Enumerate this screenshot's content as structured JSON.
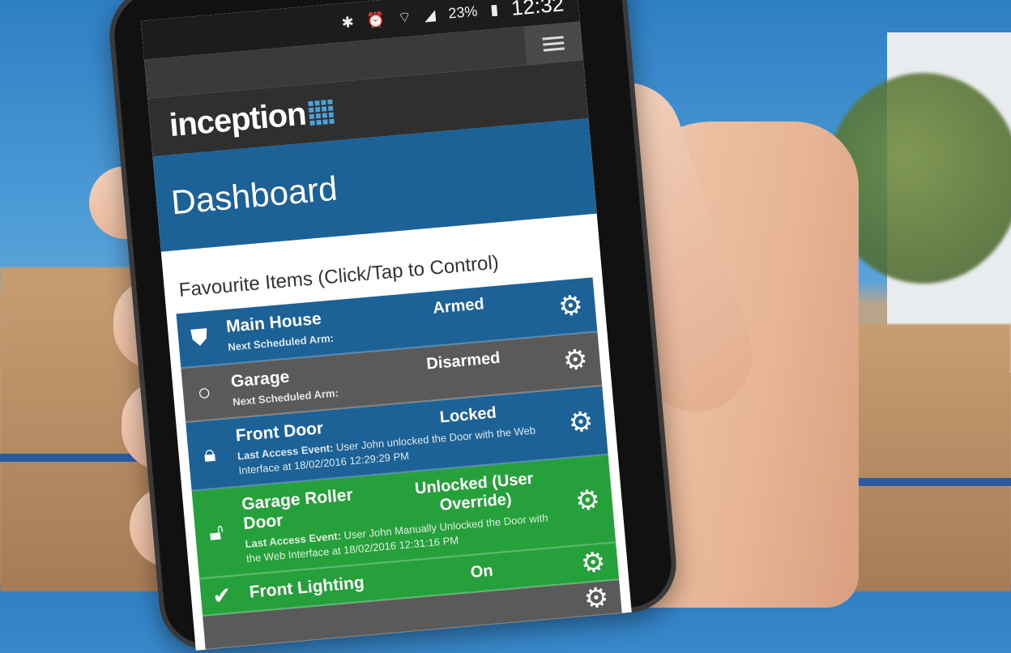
{
  "status_bar": {
    "icons": [
      "bluetooth-icon",
      "alarm-icon",
      "wifi-icon",
      "signal-icon"
    ],
    "battery": "23%",
    "time": "12:32"
  },
  "app": {
    "logo": "inception",
    "page_title": "Dashboard",
    "favourites_title": "Favourite Items (Click/Tap to Control)"
  },
  "items": [
    {
      "name": "Main House",
      "state": "Armed",
      "sub_label": "Next Scheduled Arm:",
      "sub_text": "",
      "icon": "shield-icon",
      "color": "blue"
    },
    {
      "name": "Garage",
      "state": "Disarmed",
      "sub_label": "Next Scheduled Arm:",
      "sub_text": "",
      "icon": "circle-icon",
      "color": "grey"
    },
    {
      "name": "Front Door",
      "state": "Locked",
      "sub_label": "Last Access Event:",
      "sub_text": "User John unlocked the Door with the Web Interface at 18/02/2016 12:29:29 PM",
      "icon": "lock-icon",
      "color": "blue"
    },
    {
      "name": "Garage Roller Door",
      "state": "Unlocked (User Override)",
      "sub_label": "Last Access Event:",
      "sub_text": "User John Manually Unlocked the Door with the Web Interface at 18/02/2016 12:31:16 PM",
      "icon": "unlock-icon",
      "color": "green"
    },
    {
      "name": "Front Lighting",
      "state": "On",
      "sub_label": "",
      "sub_text": "",
      "icon": "check-circle-icon",
      "color": "green"
    }
  ],
  "colors": {
    "header_blue": "#1c6296",
    "armed_grey": "#5a5a5a",
    "active_green": "#26a03a",
    "logo_bar": "#2f2f2f"
  }
}
